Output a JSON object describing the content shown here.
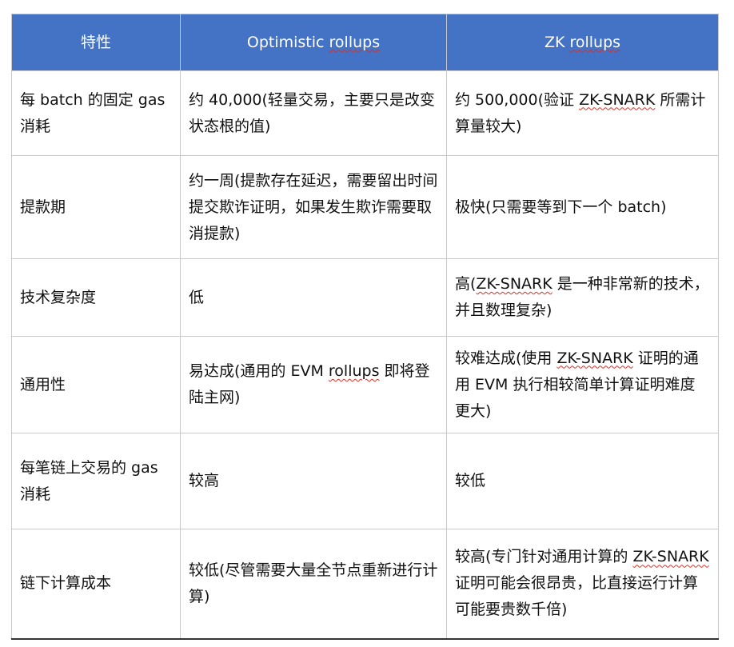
{
  "table": {
    "headers": [
      "特性",
      "Optimistic rollups",
      "ZK rollups"
    ],
    "colors": {
      "header_bg": "#4472c4",
      "header_text": "#ffffff",
      "border": "#c9c9c9",
      "spellcheck_underline": "#d93025"
    },
    "rows": [
      {
        "feature": "每 batch 的固定 gas 消耗",
        "optimistic": "约 40,000(轻量交易，主要只是改变状态根的值)",
        "zk": "约 500,000(验证 ZK-SNARK 所需计算量较大)"
      },
      {
        "feature": "提款期",
        "optimistic": "约一周(提款存在延迟，需要留出时间提交欺诈证明，如果发生欺诈需要取消提款)",
        "zk": "极快(只需要等到下一个 batch)"
      },
      {
        "feature": "技术复杂度",
        "optimistic": "低",
        "zk": "高(ZK-SNARK 是一种非常新的技术，并且数理复杂)"
      },
      {
        "feature": "通用性",
        "optimistic": "易达成(通用的 EVM rollups 即将登陆主网)",
        "zk": "较难达成(使用 ZK-SNARK 证明的通用 EVM 执行相较简单计算证明难度更大)"
      },
      {
        "feature": "每笔链上交易的 gas 消耗",
        "optimistic": "较高",
        "zk": "较低"
      },
      {
        "feature": "链下计算成本",
        "optimistic": "较低(尽管需要大量全节点重新进行计算)",
        "zk": "较高(专门针对通用计算的 ZK-SNARK 证明可能会很昂贵，比直接运行计算可能要贵数千倍)"
      }
    ]
  }
}
